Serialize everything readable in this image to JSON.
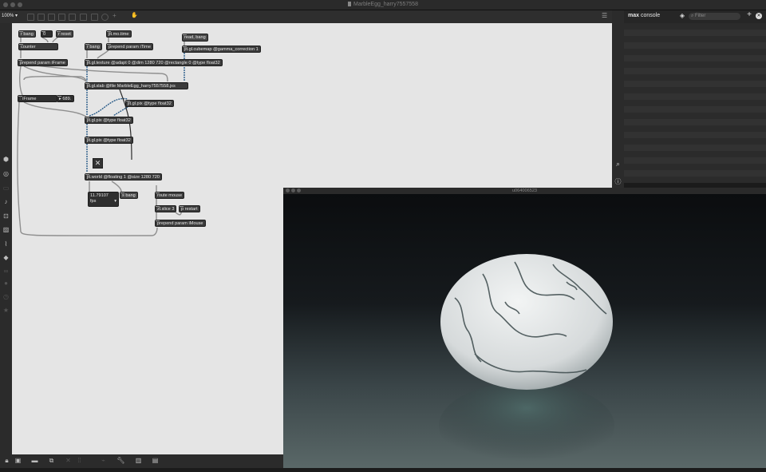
{
  "window": {
    "title": "MarbleEgg_harry7557558"
  },
  "toolbar": {
    "zoom": "100%",
    "zoom_caret": "▾"
  },
  "console": {
    "title_bold": "max",
    "title_rest": "console",
    "filter_placeholder": "Filter"
  },
  "patch": {
    "objects": {
      "r_bang_1": "r bang",
      "zero": "0",
      "r_reset": "r reset",
      "counter": "counter",
      "prepend_iframe": "prepend param iFrame",
      "r_bang_2": "r bang",
      "jit_mo_time": "jit.mo.time",
      "prepend_itime": "prepend param iTime",
      "read_bang": "read, bang",
      "cubemap": "jit.gl.cubemap @gamma_correction 1",
      "texture": "jit.gl.texture @adapt 0 @dim 1280 720 @rectangle 0 @type float32",
      "slab": "jit.gl.slab @file MarbleEgg_harry7557558.jxs",
      "iframe_label": "iFrame",
      "iframe_value": "▸ 689.",
      "pix_1": "jit.gl.pix @type float32",
      "pix_2": "jit.gl.pix @type float32",
      "pix_3": "jit.gl.pix @type float32",
      "world": "jit.world @floating 1 @size 1280 720",
      "fps_value": "11.79107",
      "fps_label": "fps",
      "s_bang": "s bang",
      "route_mouse": "route mouse",
      "zl_slice": "zl.slice 3",
      "p_restart": "p restart",
      "prepend_imouse": "prepend param iMouse"
    }
  },
  "jitter_window": {
    "title": "u064006523"
  },
  "colors": {
    "canvas": "#e5e5e5",
    "object": "#3b3b3b",
    "patchcord_blue": "#2c5d8a",
    "patchcord_gray": "#8f8f8f"
  }
}
